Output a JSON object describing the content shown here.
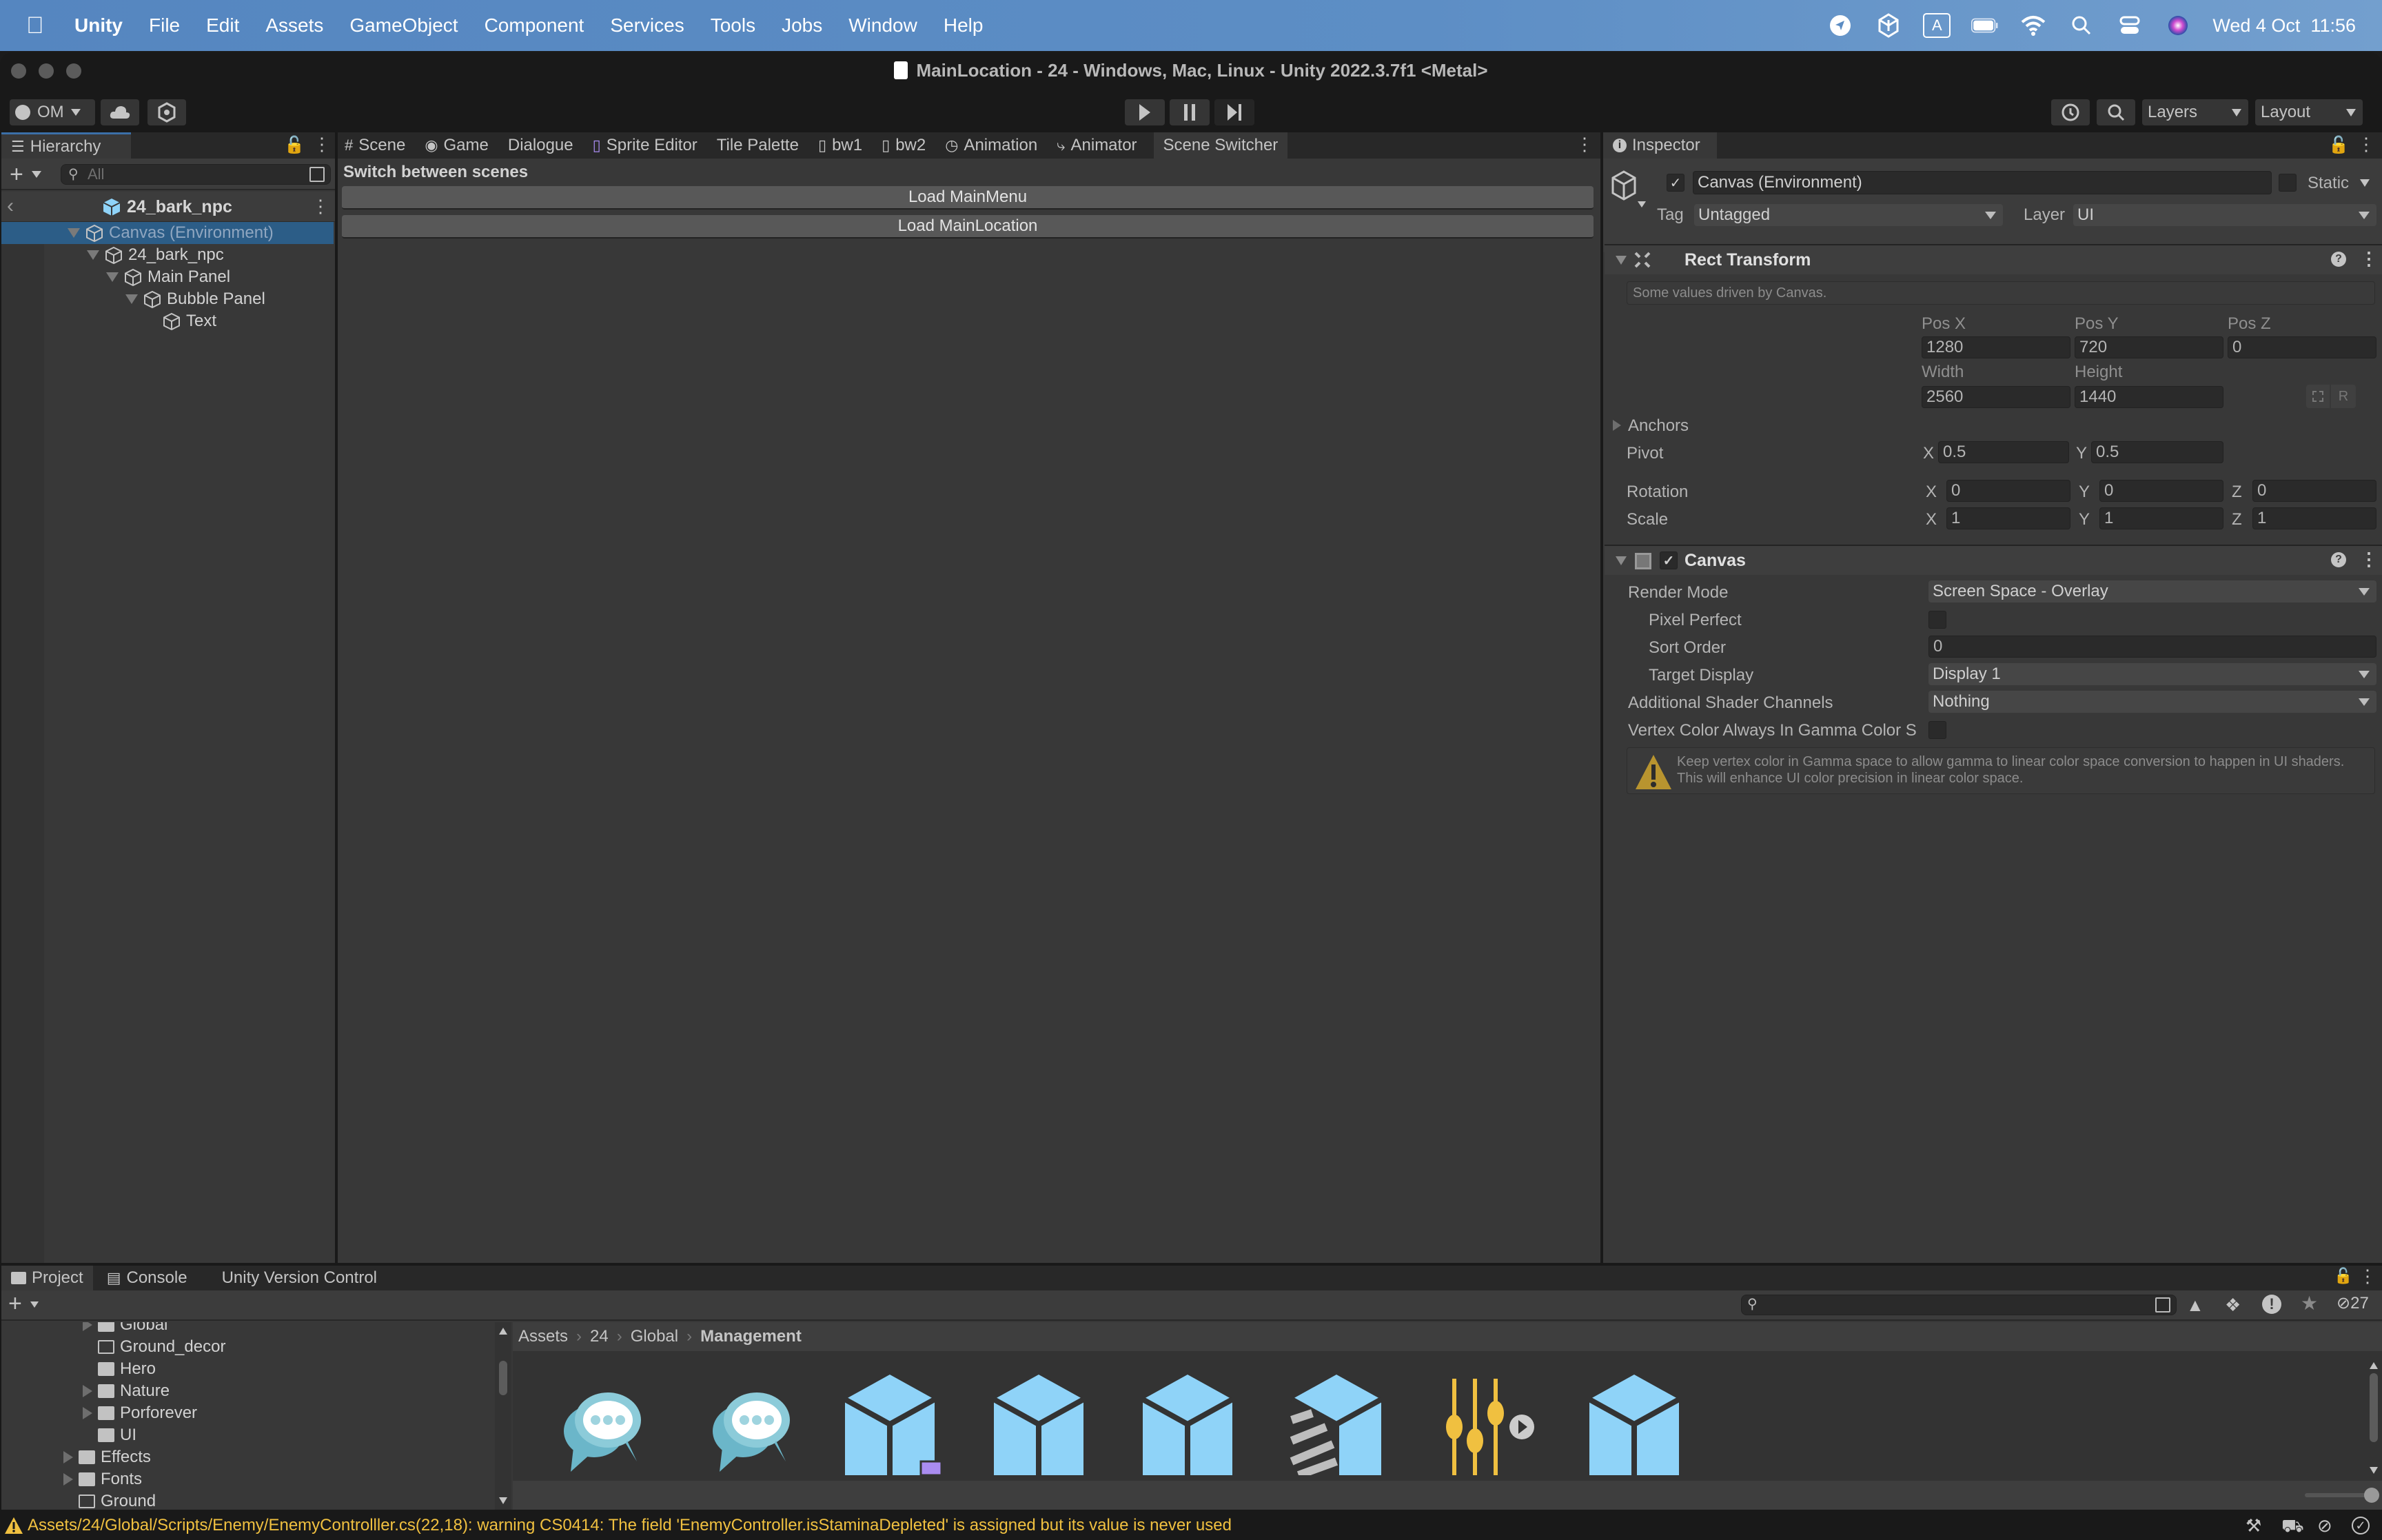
{
  "menubar": {
    "app_name": "Unity",
    "items": [
      "File",
      "Edit",
      "Assets",
      "GameObject",
      "Component",
      "Services",
      "Tools",
      "Jobs",
      "Window",
      "Help"
    ],
    "status_icons": [
      "location-icon",
      "unity-hub-icon",
      "input-source-icon",
      "battery-icon",
      "wifi-icon",
      "spotlight-search-icon",
      "control-center-icon",
      "siri-icon"
    ],
    "input_source_label": "A",
    "clock": "Wed 4 Oct  11:56"
  },
  "window": {
    "title": "MainLocation - 24 - Windows, Mac, Linux - Unity 2022.3.7f1 <Metal>"
  },
  "toolbar": {
    "account_label": "OM",
    "layers_label": "Layers",
    "layout_label": "Layout"
  },
  "hierarchy": {
    "tab_label": "Hierarchy",
    "search_placeholder": "All",
    "prefab_header": "24_bark_npc",
    "items": [
      {
        "label": "Canvas (Environment)",
        "depth": 0,
        "expanded": true,
        "selected": true
      },
      {
        "label": "24_bark_npc",
        "depth": 1,
        "expanded": true,
        "selected": false
      },
      {
        "label": "Main Panel",
        "depth": 2,
        "expanded": true,
        "selected": false
      },
      {
        "label": "Bubble Panel",
        "depth": 3,
        "expanded": true,
        "selected": false
      },
      {
        "label": "Text",
        "depth": 4,
        "expanded": false,
        "selected": false
      }
    ]
  },
  "center_tabs": [
    {
      "label": "Scene",
      "icon": "scene-grid-icon"
    },
    {
      "label": "Game",
      "icon": "gamepad-icon"
    },
    {
      "label": "Dialogue",
      "icon": ""
    },
    {
      "label": "Sprite Editor",
      "icon": "sprite-editor-icon"
    },
    {
      "label": "Tile Palette",
      "icon": ""
    },
    {
      "label": "bw1",
      "icon": "script-icon"
    },
    {
      "label": "bw2",
      "icon": "script-icon"
    },
    {
      "label": "Animation",
      "icon": "clock-icon"
    },
    {
      "label": "Animator",
      "icon": "animator-icon"
    },
    {
      "label": "Scene Switcher",
      "icon": "",
      "active": true
    }
  ],
  "scene_switcher": {
    "heading": "Switch between scenes",
    "buttons": [
      "Load MainMenu",
      "Load MainLocation"
    ]
  },
  "inspector": {
    "tab_label": "Inspector",
    "object_name": "Canvas (Environment)",
    "active": true,
    "static_label": "Static",
    "static": false,
    "tag_label": "Tag",
    "tag_value": "Untagged",
    "layer_label": "Layer",
    "layer_value": "UI",
    "rect_transform": {
      "title": "Rect Transform",
      "info": "Some values driven by Canvas.",
      "pos_x_label": "Pos X",
      "pos_x": "1280",
      "pos_y_label": "Pos Y",
      "pos_y": "720",
      "pos_z_label": "Pos Z",
      "pos_z": "0",
      "width_label": "Width",
      "width": "2560",
      "height_label": "Height",
      "height": "1440",
      "anchors_label": "Anchors",
      "pivot_label": "Pivot",
      "pivot_x": "0.5",
      "pivot_y": "0.5",
      "rotation_label": "Rotation",
      "rot_x": "0",
      "rot_y": "0",
      "rot_z": "0",
      "scale_label": "Scale",
      "scale_x": "1",
      "scale_y": "1",
      "scale_z": "1",
      "axis_x": "X",
      "axis_y": "Y",
      "axis_z": "Z",
      "raw_edit_label": "R"
    },
    "canvas": {
      "title": "Canvas",
      "enabled": true,
      "render_mode_label": "Render Mode",
      "render_mode": "Screen Space - Overlay",
      "pixel_perfect_label": "Pixel Perfect",
      "pixel_perfect": false,
      "sort_order_label": "Sort Order",
      "sort_order": "0",
      "target_display_label": "Target Display",
      "target_display": "Display 1",
      "shader_channels_label": "Additional Shader Channels",
      "shader_channels": "Nothing",
      "vertex_color_label": "Vertex Color Always In Gamma Color S",
      "vertex_color": false,
      "warning": "Keep vertex color in Gamma space to allow gamma to linear color space conversion to happen in UI shaders. This will enhance UI color precision in linear color space."
    }
  },
  "project": {
    "tabs": [
      "Project",
      "Console",
      "Unity Version Control"
    ],
    "folders": [
      {
        "label": "Global",
        "depth": 1,
        "expandable": true,
        "empty": false
      },
      {
        "label": "Ground_decor",
        "depth": 1,
        "expandable": false,
        "empty": true
      },
      {
        "label": "Hero",
        "depth": 1,
        "expandable": false,
        "empty": false
      },
      {
        "label": "Nature",
        "depth": 1,
        "expandable": true,
        "empty": false
      },
      {
        "label": "Porforever",
        "depth": 1,
        "expandable": true,
        "empty": false
      },
      {
        "label": "UI",
        "depth": 1,
        "expandable": false,
        "empty": false
      },
      {
        "label": "Effects",
        "depth": 0,
        "expandable": true,
        "empty": false
      },
      {
        "label": "Fonts",
        "depth": 0,
        "expandable": true,
        "empty": false
      },
      {
        "label": "Ground",
        "depth": 0,
        "expandable": false,
        "empty": true
      }
    ],
    "breadcrumb": [
      "Assets",
      "24",
      "Global",
      "Management"
    ],
    "hidden_count": "27",
    "assets": [
      {
        "type": "speech-bubble-icon"
      },
      {
        "type": "speech-bubble-icon"
      },
      {
        "type": "prefab-variant-icon"
      },
      {
        "type": "prefab-icon"
      },
      {
        "type": "prefab-icon"
      },
      {
        "type": "prefab-missing-icon"
      },
      {
        "type": "audio-mixer-icon"
      },
      {
        "type": "prefab-icon"
      }
    ]
  },
  "status": {
    "message": "Assets/24/Global/Scripts/Enemy/EnemyControlller.cs(22,18): warning CS0414: The field 'EnemyController.isStaminaDepleted' is assigned but its value is never used"
  },
  "colors": {
    "selection": "#2c5d87",
    "prefab_blue": "#8fd3f8",
    "warning_yellow": "#f0c040",
    "menubar_blue": "#5586c0"
  }
}
